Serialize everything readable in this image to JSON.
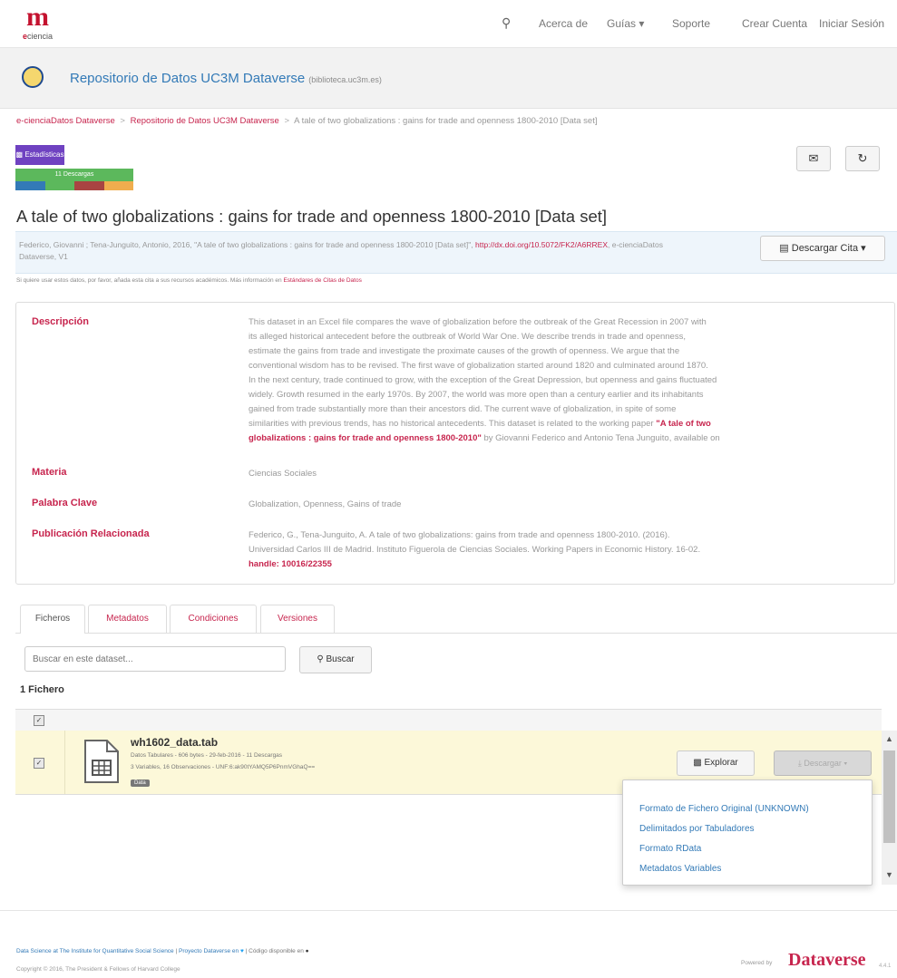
{
  "nav": {
    "logo_text": "ciencia",
    "items": [
      "Acerca de",
      "Guías",
      "Soporte",
      "Crear Cuenta",
      "Iniciar Sesión"
    ]
  },
  "repo": {
    "title": "Repositorio de Datos UC3M Dataverse",
    "subtitle": "(biblioteca.uc3m.es)"
  },
  "breadcrumb": [
    "e-cienciaDatos Dataverse",
    "Repositorio de Datos UC3M Dataverse",
    "A tale of two globalizations : gains for trade and openness 1800-2010 [Data set]"
  ],
  "metrics": {
    "stats_label": "Estadísticas",
    "downloads_label": "11 Descargas"
  },
  "title": "A tale of two globalizations : gains for trade and openness 1800-2010 [Data set]",
  "citation": {
    "text": "Federico, Giovanni ; Tena-Junguito, Antonio, 2016, \"A tale of two globalizations : gains for trade and openness 1800-2010 [Data set]\",",
    "doi": "http://dx.doi.org/10.5072/FK2/A6RREX",
    "suffix": "e-cienciaDatos Dataverse, V1",
    "button": "Descargar Cita",
    "note_prefix": "Si quiere usar estos datos, por favor, añada esta cita a sus recursos académicos. Más información en",
    "note_link": "Estándares de Citas de Datos"
  },
  "metadata": {
    "description_label": "Descripción",
    "description_lines": [
      "This dataset in an Excel file compares the wave of globalization before the outbreak of the Great Recession in 2007 with",
      "its alleged historical antecedent before the outbreak of World War One. We describe trends in trade and openness,",
      "estimate the gains from trade and investigate the proximate causes of the growth of openness. We argue that the",
      "conventional wisdom has to be revised. The first wave of globalization started around 1820 and culminated around 1870.",
      "In the next century, trade continued to grow, with the exception of the Great Depression, but openness and gains fluctuated",
      "widely. Growth resumed in the early 1970s. By 2007, the world was more open than a century earlier and its inhabitants",
      "gained from trade substantially more than their ancestors did. The current wave of globalization, in spite of some",
      "similarities with previous trends, has no historical antecedents. This dataset is related to the working paper"
    ],
    "description_link1": "\"A tale of two",
    "description_link2": "globalizations : gains for trade and openness 1800-2010\"",
    "description_end": "by Giovanni Federico and Antonio Tena Junguito, available on",
    "subject_label": "Materia",
    "subject": "Ciencias Sociales",
    "keyword_label": "Palabra Clave",
    "keywords": "Globalization, Openness, Gains of trade",
    "related_label": "Publicación Relacionada",
    "related_line1": "Federico, G., Tena-Junguito, A. A tale of two globalizations: gains from trade and openness 1800-2010. (2016).",
    "related_line2": "Universidad Carlos III de Madrid. Instituto Figuerola de Ciencias Sociales. Working Papers in Economic History. 16-02.",
    "related_handle": "handle: 10016/22355"
  },
  "tabs": [
    "Ficheros",
    "Metadatos",
    "Condiciones",
    "Versiones"
  ],
  "search": {
    "placeholder": "Buscar en este dataset...",
    "button": "Buscar"
  },
  "files_count": "1 Fichero",
  "file": {
    "name": "wh1602_data.tab",
    "meta1": "Datos Tabulares - 606 bytes - 29-feb-2016 - 11 Descargas",
    "meta2": "3 Variables, 16 Observaciones - UNF:6:ak90tYAMQ5P6PnmVGhaQ==",
    "tag": "Data",
    "explore": "Explorar",
    "download": "Descargar"
  },
  "download_menu": [
    "Formato de Fichero Original (UNKNOWN)",
    "Delimitados por Tabuladores",
    "Formato RData",
    "Metadatos Variables"
  ],
  "footer": {
    "line1_a": "Data Science at The Institute for Quantitative Social Science",
    "line1_b": "Proyecto Dataverse en",
    "line1_c": "Código disponible en",
    "line2": "Copyright © 2016, The President & Fellows of Harvard College",
    "powered": "Powered by",
    "brand": "Dataverse",
    "version": "4.4.1"
  }
}
